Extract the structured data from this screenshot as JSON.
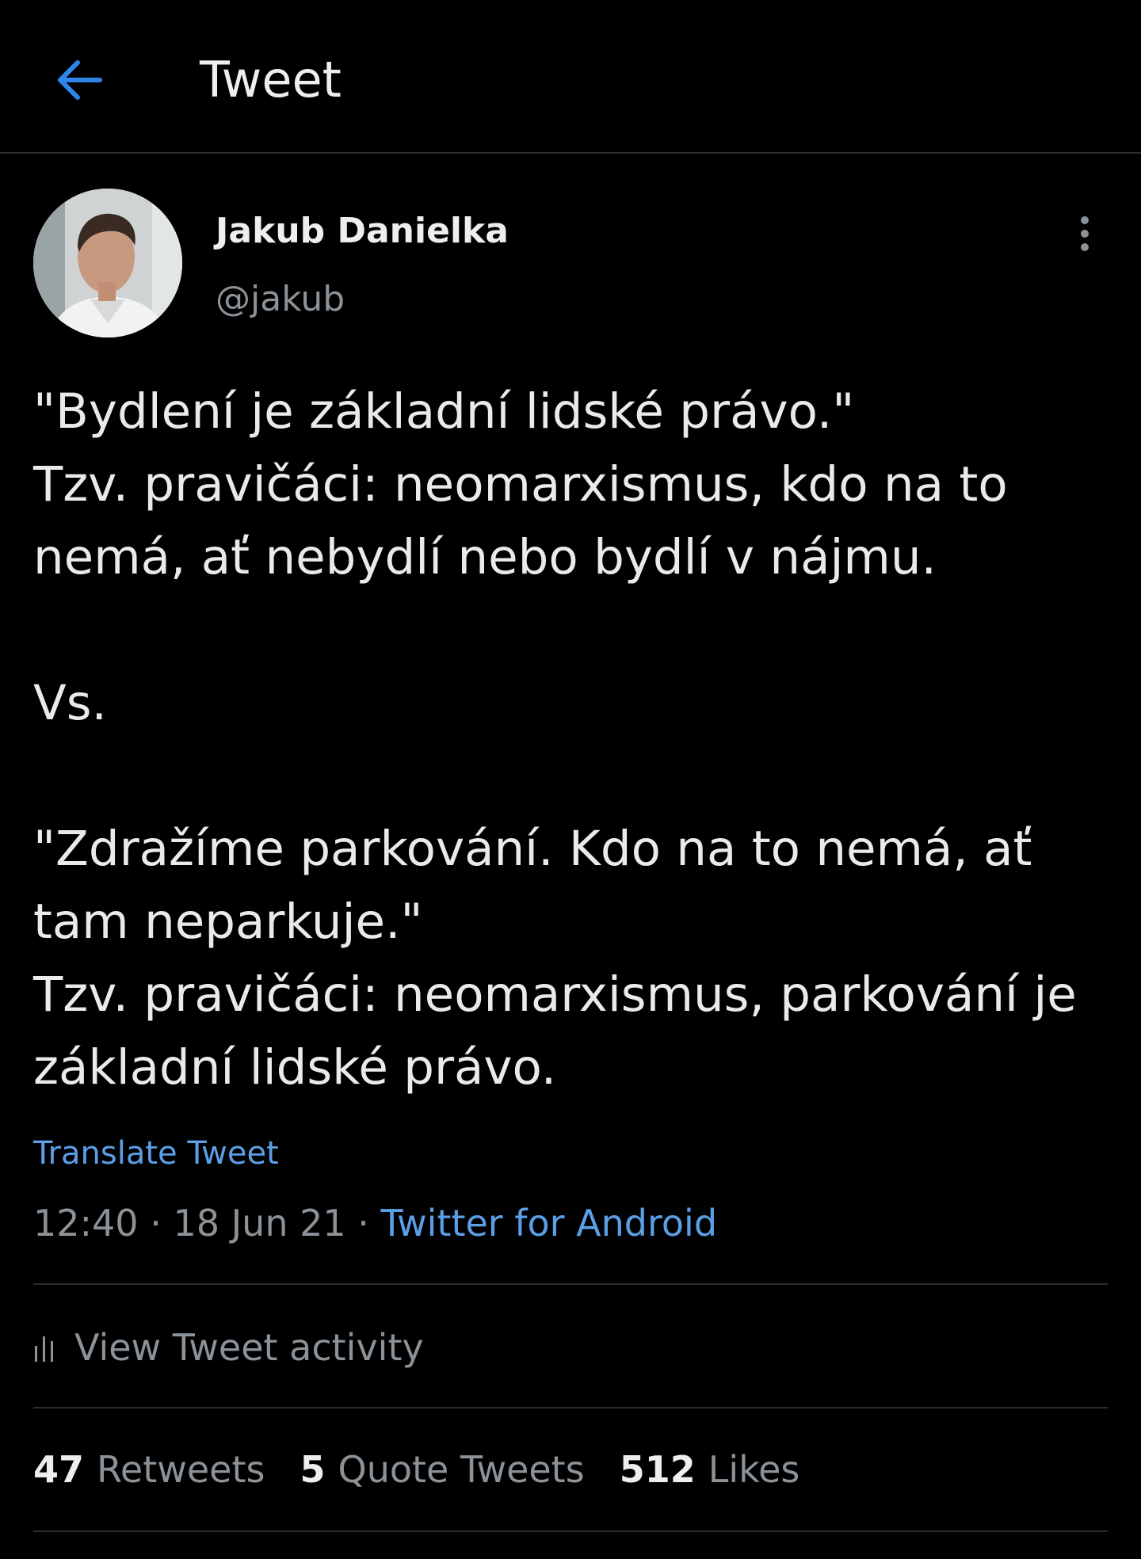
{
  "header": {
    "back_icon": "arrow-left-icon",
    "title": "Tweet",
    "accent_color": "#1d9bf0"
  },
  "author": {
    "name": "Jakub Danielka",
    "handle": "@jakub",
    "more_icon": "more-vertical-icon"
  },
  "tweet": {
    "lines": [
      "\"Bydlení je základní lidské právo.\"",
      "Tzv. pravičáci: neomarxismus, kdo na to",
      "nemá, ať nebydlí nebo bydlí v nájmu.",
      "",
      "Vs.",
      "",
      "\"Zdražíme parkování. Kdo na to nemá, ať",
      "tam neparkuje.\"",
      "Tzv. pravičáci: neomarxismus, parkování je",
      "základní lidské právo."
    ],
    "translate_label": "Translate Tweet",
    "time": "12:40",
    "separator": "·",
    "date": "18 Jun 21",
    "client": "Twitter for Android"
  },
  "activity": {
    "icon": "bar-chart-icon",
    "label": "View Tweet activity"
  },
  "stats": {
    "retweets_count": "47",
    "retweets_label": "Retweets",
    "quotes_count": "5",
    "quotes_label": "Quote Tweets",
    "likes_count": "512",
    "likes_label": "Likes"
  }
}
